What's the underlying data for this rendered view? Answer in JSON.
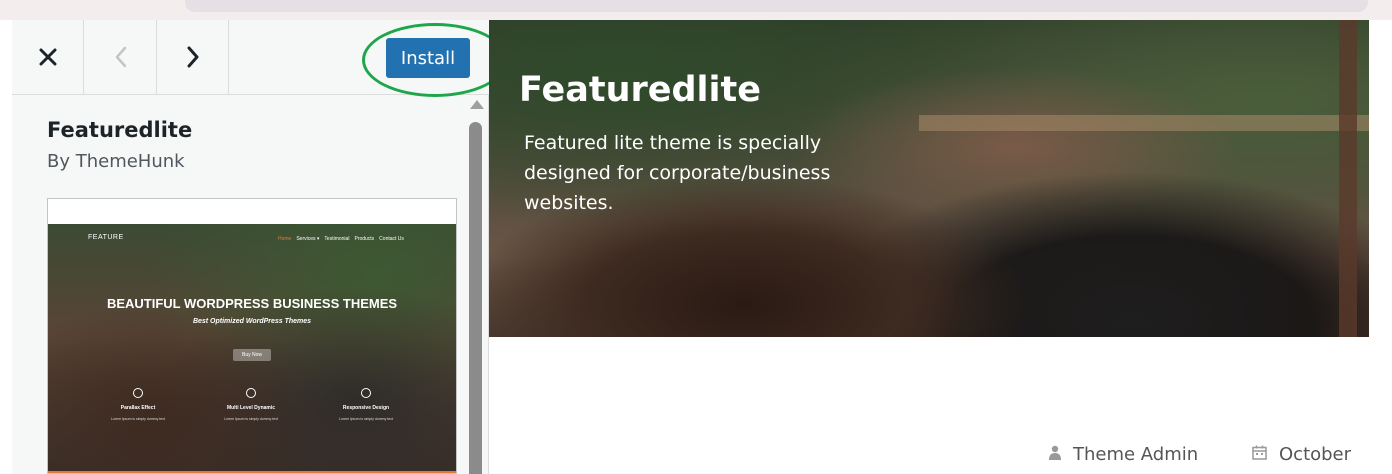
{
  "toolbar": {
    "close_icon": "×",
    "prev_icon": "‹",
    "next_icon": "›",
    "install_label": "Install"
  },
  "theme": {
    "name": "Featuredlite",
    "author": "By ThemeHunk"
  },
  "screenshot": {
    "logo": "FEATURE",
    "nav": [
      "Home",
      "Services ▾",
      "Testimonial",
      "Products",
      "Contact Us"
    ],
    "headline": "BEAUTIFUL WORDPRESS BUSINESS THEMES",
    "subheadline": "Best Optimized WordPress Themes",
    "button": "Buy Now",
    "features": [
      {
        "title": "Parallax Effect",
        "desc": "Lorem Ipsum is simply dummy text"
      },
      {
        "title": "Multi Level Dynamic",
        "desc": "Lorem Ipsum is simply dummy text"
      },
      {
        "title": "Responsive Design",
        "desc": "Lorem Ipsum is simply dummy text"
      }
    ]
  },
  "preview": {
    "title": "Featuredlite",
    "description": "Featured lite theme is specially designed for corporate/business websites.",
    "meta_author": "Theme Admin",
    "meta_date": "October"
  },
  "colors": {
    "install_bg": "#2271b1",
    "highlight_circle": "#1fa64a",
    "accent_orange": "#e0793a"
  },
  "icons": [
    "close-icon",
    "chevron-left-icon",
    "chevron-right-icon",
    "user-icon",
    "calendar-icon",
    "scroll-up-arrow-icon"
  ]
}
